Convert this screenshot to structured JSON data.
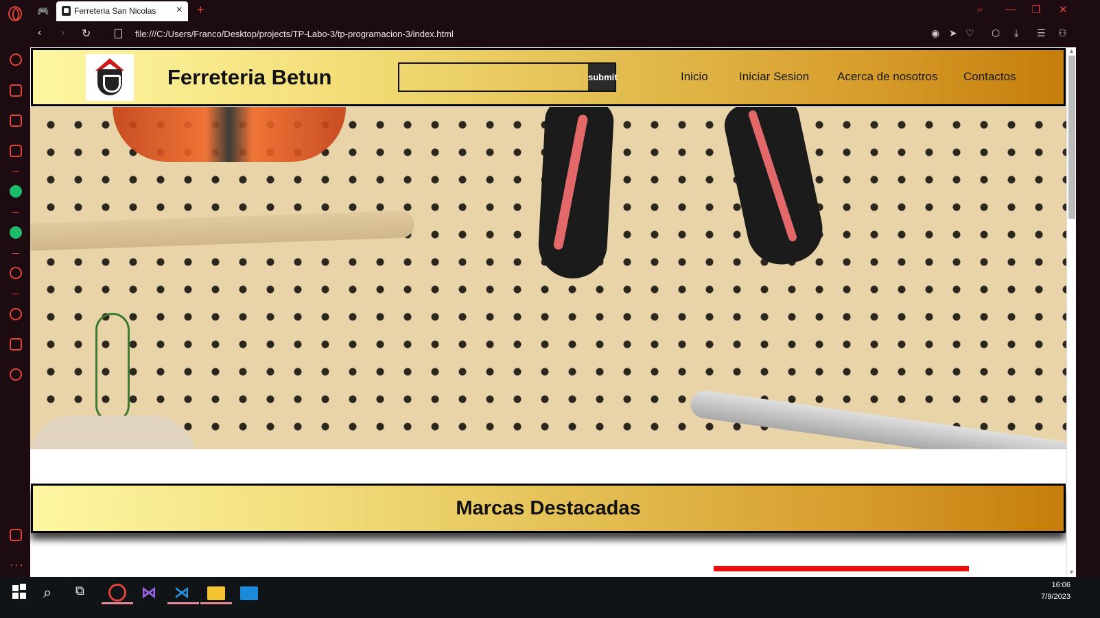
{
  "browser": {
    "tab_title": "Ferreteria San Nicolas",
    "url": "file:///C:/Users/Franco/Desktop/projects/TP-Labo-3/tp-programacion-3/index.html"
  },
  "site": {
    "title": "Ferreteria Betun",
    "search": {
      "value": "",
      "button_label": "submit"
    },
    "nav": [
      "Inicio",
      "Iniciar Sesion",
      "Acerca de nosotros",
      "Contactos"
    ],
    "section_title": "Marcas Destacadas"
  },
  "taskbar": {
    "time": "16:06",
    "date": "7/9/2023"
  },
  "colors": {
    "accent": "#e0463b",
    "header_gradient_start": "#fdf7a2",
    "header_gradient_end": "#c57d0b",
    "red_bar": "#ee0a0a"
  }
}
